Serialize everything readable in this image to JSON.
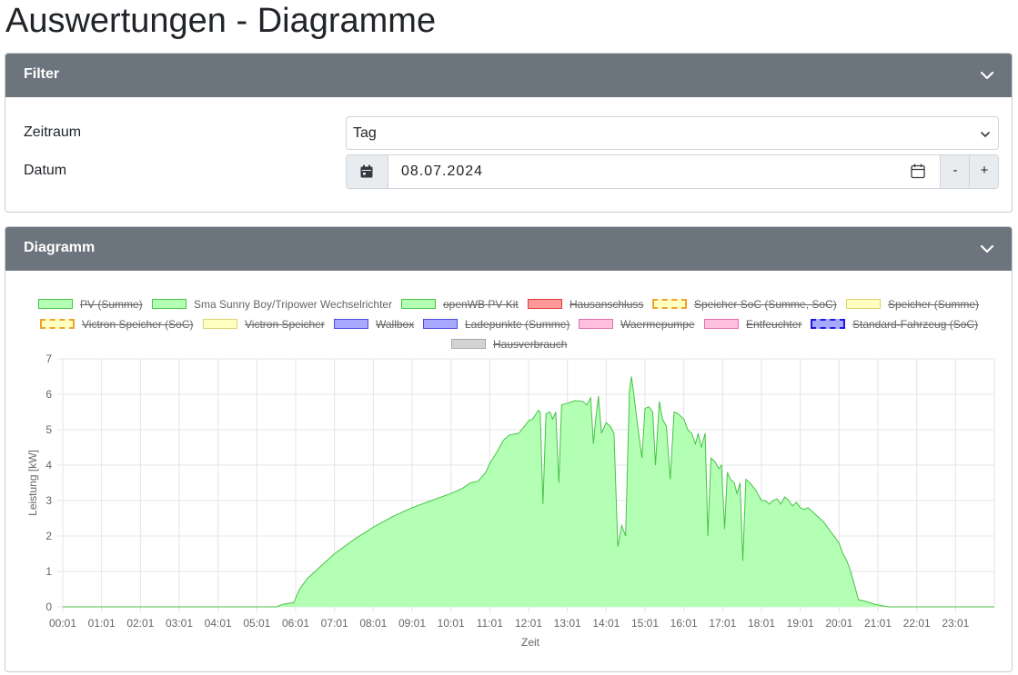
{
  "page": {
    "title": "Auswertungen - Diagramme"
  },
  "filter": {
    "header": "Filter",
    "period_label": "Zeitraum",
    "period_value": "Tag",
    "date_label": "Datum",
    "date_value": "08.07.2024",
    "minus_label": "-",
    "plus_label": "+"
  },
  "diagram": {
    "header": "Diagramm"
  },
  "legend": [
    {
      "label": "PV (Summe)",
      "hidden": true,
      "fill": "#b3ffb3",
      "border": "#47c347",
      "dashed": false
    },
    {
      "label": "Sma Sunny Boy/Tripower Wechselrichter",
      "hidden": false,
      "fill": "#b3ffb3",
      "border": "#47c347",
      "dashed": false
    },
    {
      "label": "openWB PV Kit",
      "hidden": true,
      "fill": "#b3ffb3",
      "border": "#47c347",
      "dashed": false
    },
    {
      "label": "Hausanschluss",
      "hidden": true,
      "fill": "#ff9999",
      "border": "#e03b3b",
      "dashed": false
    },
    {
      "label": "Speicher SoC (Summe, SoC)",
      "hidden": true,
      "fill": "#ffffc0",
      "border": "#f0a030",
      "dashed": true
    },
    {
      "label": "Speicher (Summe)",
      "hidden": true,
      "fill": "#ffffc0",
      "border": "#e0d070",
      "dashed": false
    },
    {
      "label": "Victron Speicher (SoC)",
      "hidden": true,
      "fill": "#ffffc0",
      "border": "#f0a030",
      "dashed": true
    },
    {
      "label": "Victron Speicher",
      "hidden": true,
      "fill": "#ffffc0",
      "border": "#e0d070",
      "dashed": false
    },
    {
      "label": "Wallbox",
      "hidden": true,
      "fill": "#a8a8ff",
      "border": "#4a4ae0",
      "dashed": false
    },
    {
      "label": "Ladepunkte (Summe)",
      "hidden": true,
      "fill": "#a8a8ff",
      "border": "#4a4ae0",
      "dashed": false
    },
    {
      "label": "Waermepumpe",
      "hidden": true,
      "fill": "#ffc0e0",
      "border": "#e070b0",
      "dashed": false
    },
    {
      "label": "Entfeuchter",
      "hidden": true,
      "fill": "#ffc0e0",
      "border": "#e070b0",
      "dashed": false
    },
    {
      "label": "Standard-Fahrzeug (SoC)",
      "hidden": true,
      "fill": "#a8a8ff",
      "border": "#1a1ae0",
      "dashed": true
    },
    {
      "label": "Hausverbrauch",
      "hidden": true,
      "fill": "#d3d3d3",
      "border": "#aaaaaa",
      "dashed": false
    }
  ],
  "chart_data": {
    "type": "area",
    "xlabel": "Zeit",
    "ylabel": "Leistung [kW]",
    "ylim": [
      0,
      7
    ],
    "yticks": [
      "0",
      "1",
      "2",
      "3",
      "4",
      "5",
      "6",
      "7"
    ],
    "xticks": [
      "00:01",
      "01:01",
      "02:01",
      "03:01",
      "04:01",
      "05:01",
      "06:01",
      "07:01",
      "08:01",
      "09:01",
      "10:01",
      "11:01",
      "12:01",
      "13:01",
      "14:01",
      "15:01",
      "16:01",
      "17:01",
      "18:01",
      "19:01",
      "20:01",
      "21:01",
      "22:01",
      "23:01"
    ],
    "grid": true,
    "series": [
      {
        "name": "Sma Sunny Boy/Tripower Wechselrichter",
        "color": "#47c347",
        "fill": "#b3ffb3",
        "points": [
          [
            0.0,
            0
          ],
          [
            5.5,
            0
          ],
          [
            5.7,
            0.08
          ],
          [
            5.95,
            0.12
          ],
          [
            6.1,
            0.5
          ],
          [
            6.3,
            0.8
          ],
          [
            6.6,
            1.1
          ],
          [
            7.0,
            1.5
          ],
          [
            7.5,
            1.9
          ],
          [
            8.0,
            2.25
          ],
          [
            8.5,
            2.55
          ],
          [
            9.0,
            2.8
          ],
          [
            9.5,
            3.0
          ],
          [
            10.0,
            3.2
          ],
          [
            10.3,
            3.35
          ],
          [
            10.5,
            3.5
          ],
          [
            10.7,
            3.55
          ],
          [
            10.9,
            3.8
          ],
          [
            11.0,
            4.05
          ],
          [
            11.2,
            4.4
          ],
          [
            11.35,
            4.7
          ],
          [
            11.5,
            4.85
          ],
          [
            11.75,
            4.9
          ],
          [
            12.0,
            5.25
          ],
          [
            12.1,
            5.3
          ],
          [
            12.2,
            5.45
          ],
          [
            12.25,
            5.55
          ],
          [
            12.3,
            5.5
          ],
          [
            12.37,
            2.9
          ],
          [
            12.45,
            5.45
          ],
          [
            12.55,
            5.5
          ],
          [
            12.62,
            5.3
          ],
          [
            12.7,
            5.5
          ],
          [
            12.78,
            3.5
          ],
          [
            12.85,
            5.7
          ],
          [
            13.0,
            5.75
          ],
          [
            13.2,
            5.82
          ],
          [
            13.4,
            5.8
          ],
          [
            13.5,
            5.7
          ],
          [
            13.55,
            5.8
          ],
          [
            13.6,
            5.9
          ],
          [
            13.67,
            4.6
          ],
          [
            13.72,
            5.2
          ],
          [
            13.8,
            5.95
          ],
          [
            13.88,
            4.9
          ],
          [
            14.0,
            5.2
          ],
          [
            14.1,
            5.1
          ],
          [
            14.2,
            4.9
          ],
          [
            14.3,
            1.7
          ],
          [
            14.4,
            2.3
          ],
          [
            14.5,
            2.0
          ],
          [
            14.6,
            6.1
          ],
          [
            14.65,
            6.5
          ],
          [
            14.7,
            6.1
          ],
          [
            14.8,
            5.2
          ],
          [
            14.92,
            4.2
          ],
          [
            15.0,
            5.6
          ],
          [
            15.1,
            5.65
          ],
          [
            15.2,
            5.5
          ],
          [
            15.27,
            4.0
          ],
          [
            15.37,
            5.8
          ],
          [
            15.45,
            5.3
          ],
          [
            15.55,
            5.1
          ],
          [
            15.65,
            3.6
          ],
          [
            15.75,
            5.5
          ],
          [
            15.85,
            5.45
          ],
          [
            16.0,
            5.3
          ],
          [
            16.1,
            5.0
          ],
          [
            16.2,
            4.9
          ],
          [
            16.3,
            4.6
          ],
          [
            16.37,
            4.9
          ],
          [
            16.45,
            4.5
          ],
          [
            16.55,
            4.9
          ],
          [
            16.62,
            2.0
          ],
          [
            16.7,
            4.2
          ],
          [
            16.8,
            4.1
          ],
          [
            16.9,
            3.9
          ],
          [
            16.97,
            4.0
          ],
          [
            17.05,
            2.2
          ],
          [
            17.12,
            3.8
          ],
          [
            17.2,
            3.6
          ],
          [
            17.3,
            3.5
          ],
          [
            17.37,
            3.2
          ],
          [
            17.45,
            3.5
          ],
          [
            17.52,
            1.3
          ],
          [
            17.6,
            3.6
          ],
          [
            17.7,
            3.5
          ],
          [
            17.85,
            3.3
          ],
          [
            18.0,
            3.0
          ],
          [
            18.1,
            3.0
          ],
          [
            18.2,
            2.9
          ],
          [
            18.3,
            3.0
          ],
          [
            18.4,
            3.05
          ],
          [
            18.5,
            2.9
          ],
          [
            18.6,
            3.1
          ],
          [
            18.7,
            3.0
          ],
          [
            18.8,
            2.85
          ],
          [
            18.9,
            2.95
          ],
          [
            19.0,
            2.8
          ],
          [
            19.1,
            2.75
          ],
          [
            19.2,
            2.8
          ],
          [
            19.3,
            2.7
          ],
          [
            19.4,
            2.6
          ],
          [
            19.5,
            2.5
          ],
          [
            19.6,
            2.4
          ],
          [
            19.7,
            2.25
          ],
          [
            19.8,
            2.1
          ],
          [
            19.9,
            1.95
          ],
          [
            20.0,
            1.8
          ],
          [
            20.1,
            1.5
          ],
          [
            20.2,
            1.3
          ],
          [
            20.3,
            1.0
          ],
          [
            20.4,
            0.6
          ],
          [
            20.5,
            0.2
          ],
          [
            20.7,
            0.15
          ],
          [
            20.9,
            0.08
          ],
          [
            21.1,
            0.03
          ],
          [
            21.3,
            0
          ],
          [
            24.0,
            0
          ]
        ]
      }
    ]
  }
}
